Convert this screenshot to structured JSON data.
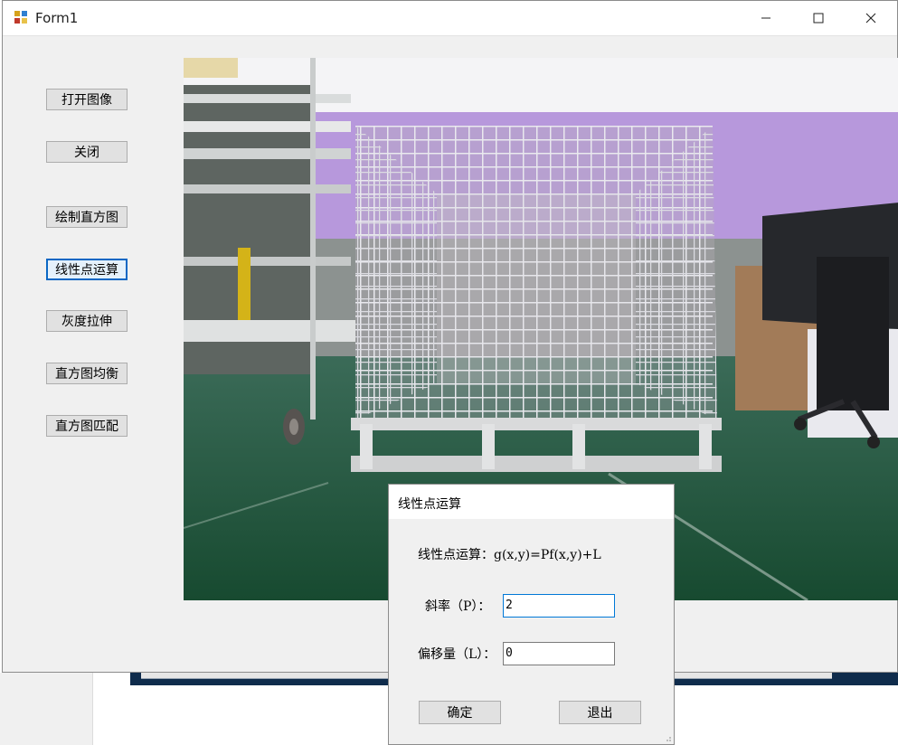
{
  "window": {
    "title": "Form1",
    "icon": "app-form-icon",
    "controls": [
      "minimize-icon",
      "maximize-icon",
      "close-icon"
    ]
  },
  "sidebar": {
    "buttons": [
      {
        "label": "打开图像"
      },
      {
        "label": "关闭"
      },
      {
        "label": "绘制直方图"
      },
      {
        "label": "线性点运算"
      },
      {
        "label": "灰度拉伸"
      },
      {
        "label": "直方图均衡"
      },
      {
        "label": "直方图匹配"
      }
    ]
  },
  "dialog": {
    "title": "线性点运算",
    "formula": "线性点运算：g(x,y)=Pf(x,y)+L",
    "slope_label": "斜率（P）：",
    "slope_value": "2",
    "offset_label": "偏移量（L）：",
    "offset_value": "0",
    "ok_label": "确定",
    "exit_label": "退出"
  }
}
